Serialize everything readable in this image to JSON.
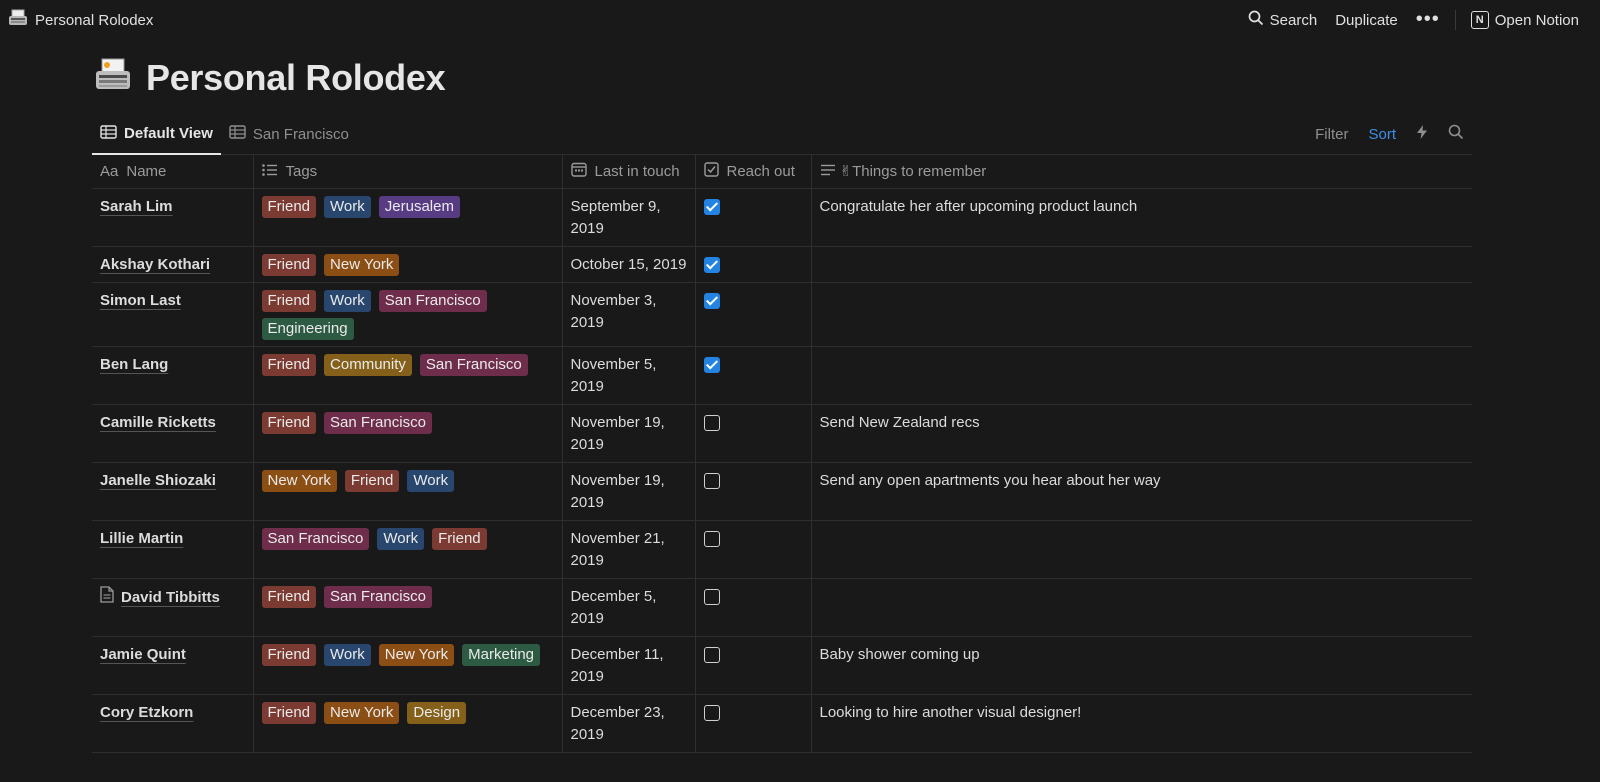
{
  "topbar": {
    "title": "Personal Rolodex",
    "search_label": "Search",
    "duplicate_label": "Duplicate",
    "more_label": "•••",
    "open_label": "Open Notion"
  },
  "page": {
    "title": "Personal Rolodex"
  },
  "views": {
    "tabs": [
      {
        "label": "Default View",
        "active": true
      },
      {
        "label": "San Francisco",
        "active": false
      }
    ],
    "filter_label": "Filter",
    "sort_label": "Sort"
  },
  "columns": {
    "name": "Name",
    "name_prefix": "Aa",
    "tags": "Tags",
    "last_in_touch": "Last in touch",
    "reach_out": "Reach out",
    "things": "✌Things to remember"
  },
  "tag_colors": {
    "Friend": "#7b3b32",
    "Work": "#29466f",
    "Jerusalem": "#573c84",
    "New York": "#8b4e14",
    "San Francisco": "#6e2d4a",
    "Engineering": "#2c5a42",
    "Community": "#84601b",
    "Marketing": "#2c5a42",
    "Design": "#84601b"
  },
  "rows": [
    {
      "name": "Sarah Lim",
      "tags": [
        "Friend",
        "Work",
        "Jerusalem"
      ],
      "date": "September 9, 2019",
      "reach_out": true,
      "note": "Congratulate her after upcoming product launch"
    },
    {
      "name": "Akshay Kothari",
      "tags": [
        "Friend",
        "New York"
      ],
      "date": "October 15, 2019",
      "reach_out": true,
      "note": ""
    },
    {
      "name": "Simon Last",
      "tags": [
        "Friend",
        "Work",
        "San Francisco",
        "Engineering"
      ],
      "date": "November 3, 2019",
      "reach_out": true,
      "note": ""
    },
    {
      "name": "Ben Lang",
      "tags": [
        "Friend",
        "Community",
        "San Francisco"
      ],
      "date": "November 5, 2019",
      "reach_out": true,
      "note": ""
    },
    {
      "name": "Camille Ricketts",
      "tags": [
        "Friend",
        "San Francisco"
      ],
      "date": "November 19, 2019",
      "reach_out": false,
      "note": "Send New Zealand recs"
    },
    {
      "name": "Janelle Shiozaki",
      "tags": [
        "New York",
        "Friend",
        "Work"
      ],
      "date": "November 19, 2019",
      "reach_out": false,
      "note": "Send any open apartments you hear about her way"
    },
    {
      "name": "Lillie Martin",
      "tags": [
        "San Francisco",
        "Work",
        "Friend"
      ],
      "date": "November 21, 2019",
      "reach_out": false,
      "note": ""
    },
    {
      "name": "David Tibbitts",
      "doc_icon": true,
      "tags": [
        "Friend",
        "San Francisco"
      ],
      "date": "December 5, 2019",
      "reach_out": false,
      "note": ""
    },
    {
      "name": "Jamie Quint",
      "tags": [
        "Friend",
        "Work",
        "New York",
        "Marketing"
      ],
      "date": "December 11, 2019",
      "reach_out": false,
      "note": "Baby shower coming up"
    },
    {
      "name": "Cory Etzkorn",
      "tags": [
        "Friend",
        "New York",
        "Design"
      ],
      "date": "December 23, 2019",
      "reach_out": false,
      "note": "Looking to hire another visual designer!"
    }
  ]
}
